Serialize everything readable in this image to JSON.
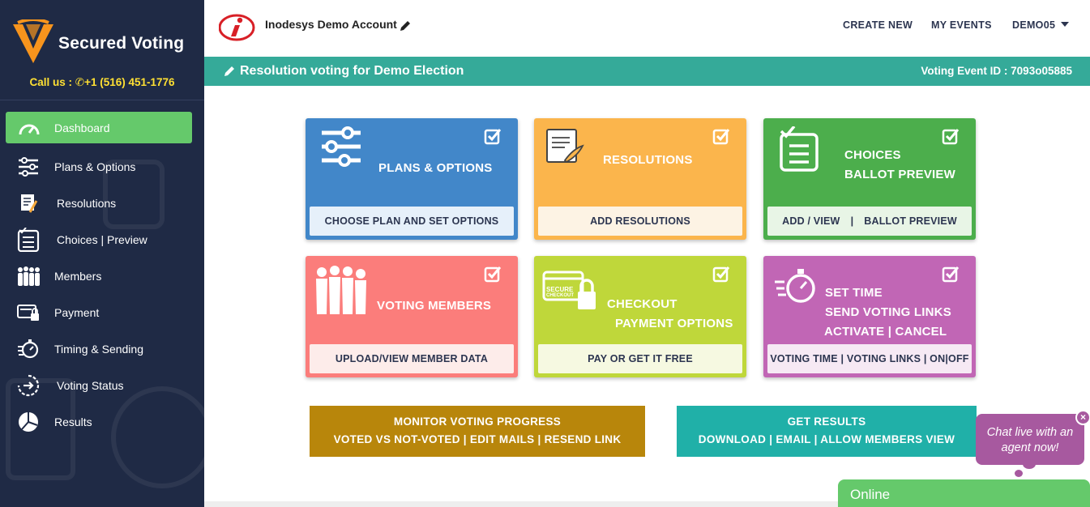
{
  "sidebar": {
    "brand": "Secured Voting",
    "call_label": "Call us :",
    "phone": "+1 (516) 451-1776",
    "items": [
      {
        "label": "Dashboard",
        "icon": "gauge-icon",
        "active": true
      },
      {
        "label": "Plans & Options",
        "icon": "sliders-icon"
      },
      {
        "label": "Resolutions",
        "icon": "scroll-icon"
      },
      {
        "label": "Choices | Preview",
        "icon": "checklist-icon"
      },
      {
        "label": "Members",
        "icon": "people-icon"
      },
      {
        "label": "Payment",
        "icon": "payment-icon"
      },
      {
        "label": "Timing & Sending",
        "icon": "stopwatch-icon"
      },
      {
        "label": "Voting Status",
        "icon": "status-icon"
      },
      {
        "label": "Results",
        "icon": "pie-icon"
      }
    ]
  },
  "header": {
    "account": "Inodesys Demo Account",
    "nav": {
      "create_new": "CREATE NEW",
      "my_events": "MY EVENTS",
      "user": "DEMO05"
    }
  },
  "titlebar": {
    "title": "Resolution voting for Demo Election",
    "event_id": "Voting Event ID : 7093o05885"
  },
  "cards": {
    "plans": {
      "title": "PLANS & OPTIONS",
      "button": "CHOOSE PLAN AND SET OPTIONS",
      "color": "#4287c9"
    },
    "resolutions": {
      "title": "RESOLUTIONS",
      "button": "ADD RESOLUTIONS",
      "color": "#fbb54c"
    },
    "choices": {
      "title_1": "CHOICES",
      "title_2": "BALLOT PREVIEW",
      "button_left": "ADD / VIEW",
      "button_sep": "|",
      "button_right": "BALLOT PREVIEW",
      "color": "#4cae4c"
    },
    "members": {
      "title": "VOTING MEMBERS",
      "button": "UPLOAD/VIEW MEMBER DATA",
      "color": "#fb7d7b"
    },
    "checkout": {
      "title_1": "CHECKOUT",
      "title_2": "PAYMENT OPTIONS",
      "button": "PAY OR GET IT FREE",
      "icon_text_1": "SECURE",
      "icon_text_2": "CHECKOUT",
      "color": "#bfd73a"
    },
    "timing": {
      "title_1": "SET TIME",
      "title_2": "SEND VOTING LINKS",
      "title_3": "ACTIVATE | CANCEL",
      "button": "VOTING TIME | VOTING LINKS | ON|OFF",
      "color": "#c166b5"
    }
  },
  "actions": {
    "monitor": {
      "line1": "MONITOR VOTING PROGRESS",
      "line2": "VOTED VS NOT-VOTED | EDIT MAILS | RESEND LINK",
      "color": "#b8860b"
    },
    "results": {
      "line1": "GET RESULTS",
      "line2": "DOWNLOAD | EMAIL | ALLOW MEMBERS VIEW",
      "color": "#20b0a8"
    }
  },
  "chat": {
    "bubble_line1": "Chat live with an",
    "bubble_line2": "agent now!",
    "close": "×",
    "status": "Online"
  }
}
